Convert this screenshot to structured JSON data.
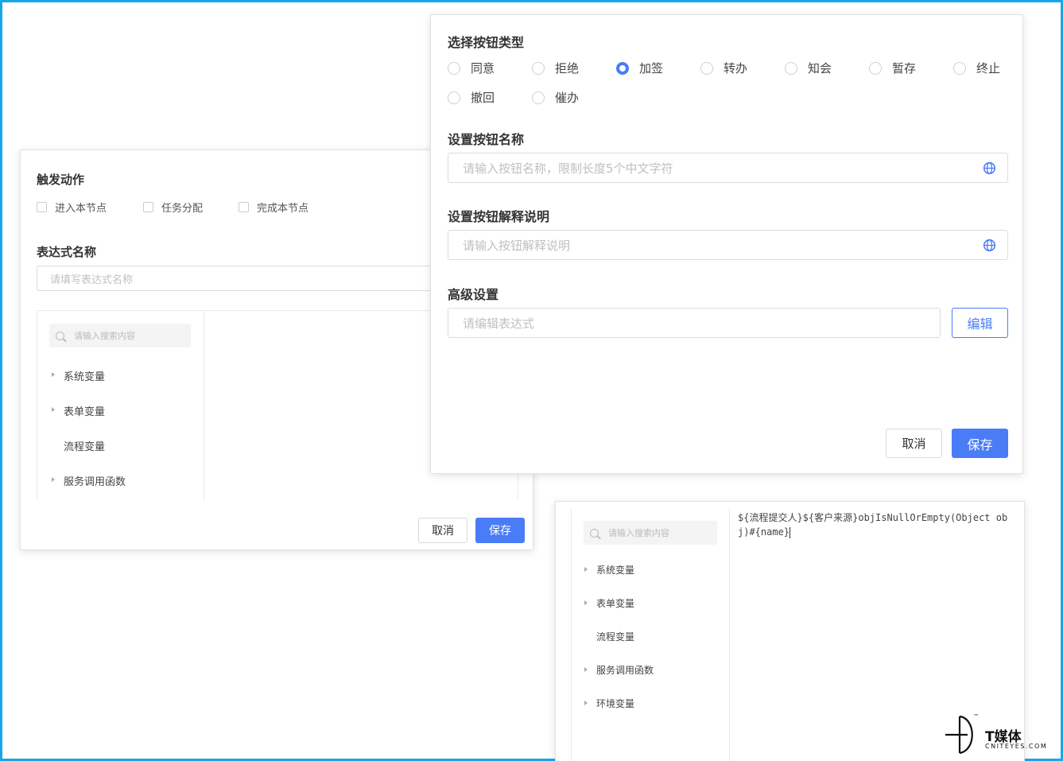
{
  "left_panel": {
    "trigger_title": "触发动作",
    "checkboxes": [
      "进入本节点",
      "任务分配",
      "完成本节点"
    ],
    "expr_name_title": "表达式名称",
    "expr_name_placeholder": "请填写表达式名称",
    "search_placeholder": "请输入搜索内容",
    "tree_items": [
      "系统变量",
      "表单变量",
      "流程变量",
      "服务调用函数"
    ],
    "cancel_label": "取消",
    "save_label": "保存"
  },
  "right_panel": {
    "type_title": "选择按钮类型",
    "button_types": [
      "同意",
      "拒绝",
      "加签",
      "转办",
      "知会",
      "暂存",
      "终止",
      "撤回",
      "催办"
    ],
    "selected_type": "加签",
    "name_title": "设置按钮名称",
    "name_placeholder": "请输入按钮名称，限制长度5个中文字符",
    "desc_title": "设置按钮解释说明",
    "desc_placeholder": "请输入按钮解释说明",
    "advanced_title": "高级设置",
    "expr_placeholder": "请编辑表达式",
    "edit_label": "编辑",
    "cancel_label": "取消",
    "save_label": "保存"
  },
  "bottom_panel": {
    "search_placeholder": "请输入搜索内容",
    "tree_items": [
      "系统变量",
      "表单变量",
      "流程变量",
      "服务调用函数",
      "环境变量"
    ],
    "code_text": "${流程提交人}${客户来源}objIsNullOrEmpty(Object obj)#{name}"
  },
  "watermark": {
    "brand": "T媒体",
    "domain": "CNITEYES.COM",
    "tm": "™"
  },
  "colors": {
    "primary": "#4a7cf7",
    "frame": "#19a6e8"
  }
}
